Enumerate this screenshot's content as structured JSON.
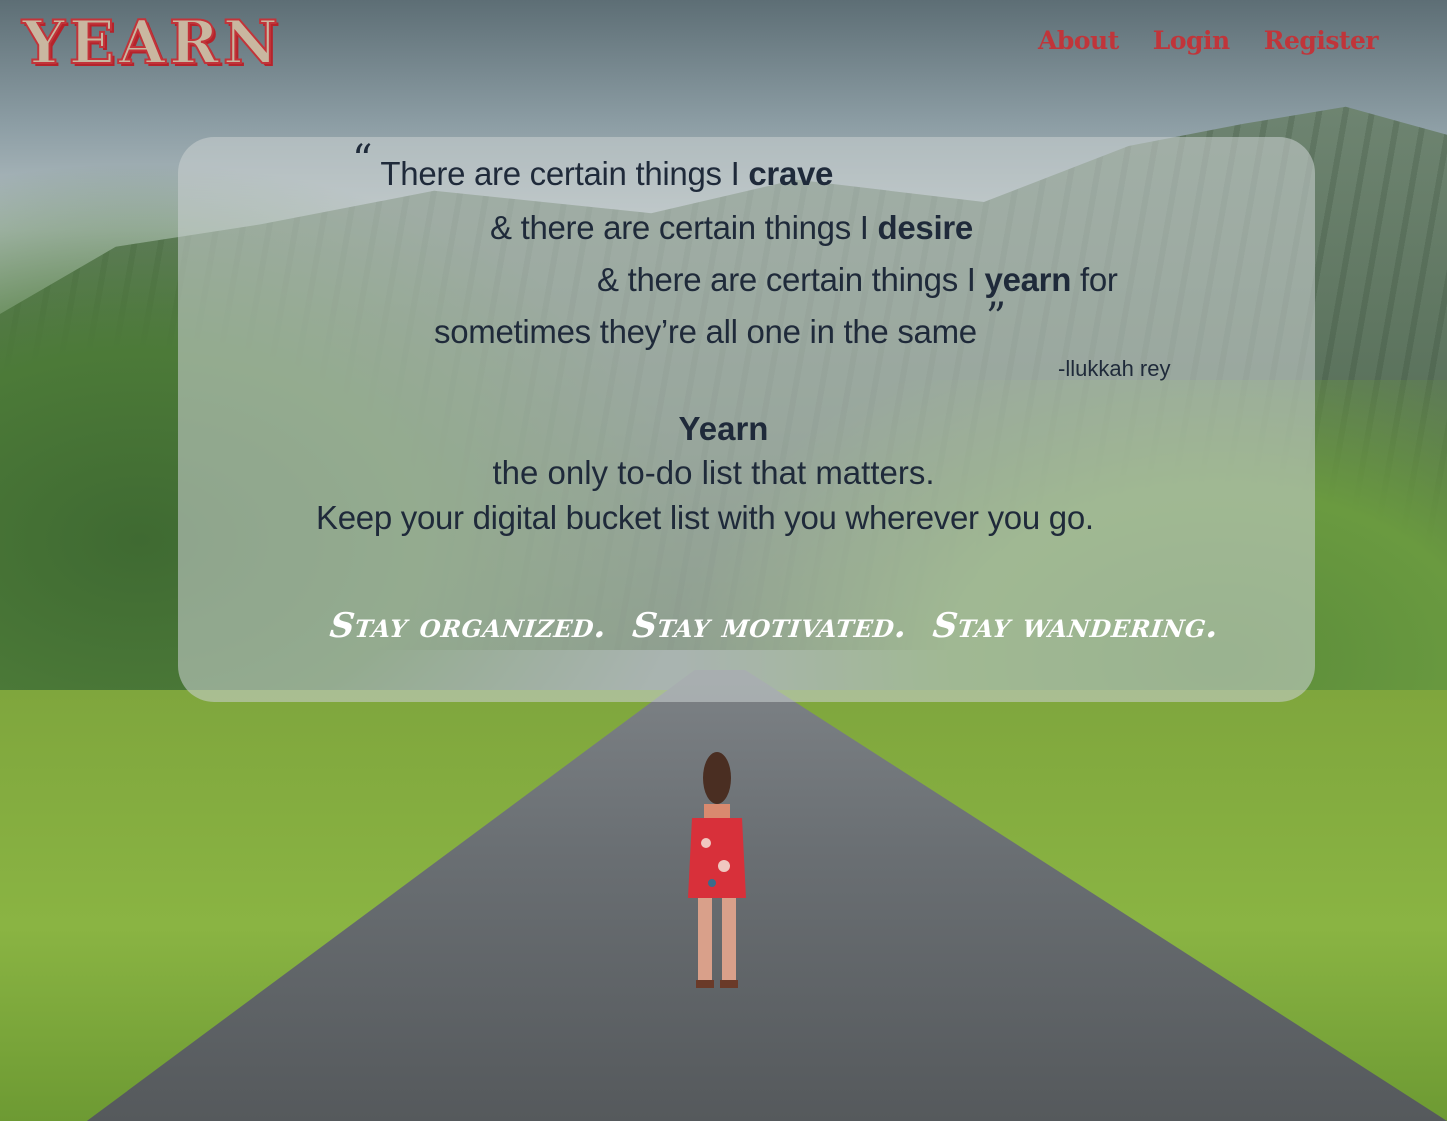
{
  "brand": {
    "logo_text": "YEARN"
  },
  "nav": {
    "about": "About",
    "login": "Login",
    "register": "Register"
  },
  "quote": {
    "open_mark": "“",
    "line1_prefix": " There are certain things I ",
    "line1_bold": "crave",
    "line2_prefix": "& there are certain things I ",
    "line2_bold": "desire",
    "line3_prefix": "& there are certain things I ",
    "line3_bold": "yearn",
    "line3_suffix": " for",
    "line4": "sometimes they’re all one in the same ",
    "close_mark": "”",
    "author": "-llukkah rey"
  },
  "intro": {
    "title": "Yearn",
    "tagline": "the only to-do list that matters.",
    "description": "Keep your digital bucket list with you wherever you go."
  },
  "slogan": [
    "Stay organized.",
    "Stay motivated.",
    "Stay wandering."
  ],
  "colors": {
    "accent": "#c0353a",
    "text": "#1f2a3a",
    "card": "rgba(200,206,206,0.58)"
  }
}
